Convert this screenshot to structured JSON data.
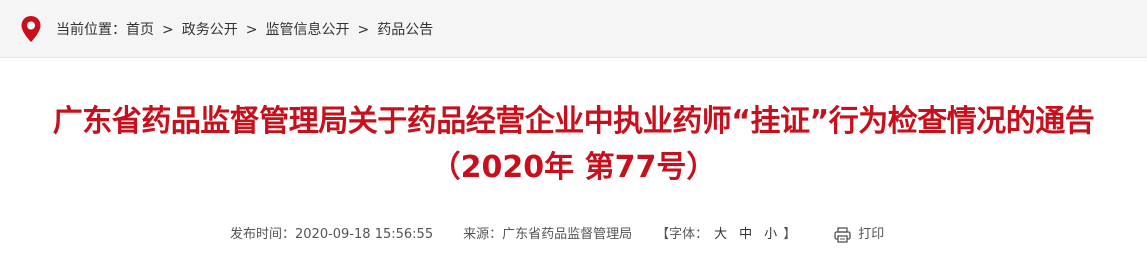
{
  "breadcrumb": {
    "prefix": "当前位置：",
    "separator": ">",
    "items": [
      "首页",
      "政务公开",
      "监管信息公开",
      "药品公告"
    ]
  },
  "article": {
    "title_line1": "广东省药品监督管理局关于药品经营企业中执业药师“挂证”行为检查情况的通告",
    "title_line2": "（2020年 第77号）"
  },
  "meta": {
    "publish_label": "发布时间：",
    "publish_time": "2020-09-18 15:56:55",
    "source_label": "来源：",
    "source": "广东省药品监督管理局",
    "font_open": "【字体：",
    "font_large": "大",
    "font_medium": "中",
    "font_small": "小",
    "font_close": "】",
    "print_label": "打印"
  },
  "colors": {
    "accent": "#c8101c",
    "breadcrumb_bg": "#f5f5f5"
  },
  "icons": {
    "location": "location-pin-icon",
    "print": "printer-icon"
  }
}
